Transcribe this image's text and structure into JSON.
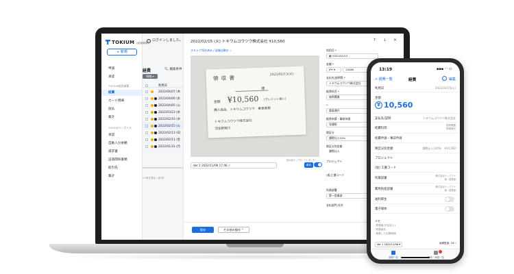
{
  "laptop": {
    "logo": "TOKIUM",
    "logo_sub": "(経費精算)",
    "new_button": "+ 新規",
    "login_message": "ログインしました。",
    "nav": [
      {
        "label": "申請"
      },
      {
        "label": "承認"
      }
    ],
    "nav_section_1": "TOKIUM経費精算",
    "nav_group_1": [
      {
        "label": "経費",
        "active": true
      },
      {
        "label": "カード明細"
      },
      {
        "label": "仮払"
      },
      {
        "label": "集計"
      }
    ],
    "nav_section_2": "TOKIUMインボイス",
    "nav_group_2": [
      {
        "label": "承認"
      },
      {
        "label": "自動入力依頼"
      },
      {
        "label": "請求書"
      },
      {
        "label": "証憑関係書類"
      },
      {
        "label": "取引先"
      },
      {
        "label": "集計"
      }
    ],
    "list": {
      "title": "経費",
      "search": "検索条件",
      "filter": "明細",
      "header_date": "利用日",
      "rows": [
        {
          "date": "2022/04/07 (木"
        },
        {
          "date": "2022/04/06 (水"
        },
        {
          "date": "2022/04/05 (火"
        },
        {
          "date": "2022/03/23 (水"
        },
        {
          "date": "2022/02/16 (水"
        },
        {
          "date": "2022/02/15 (火",
          "selected": true
        },
        {
          "date": "2022/02/13 (日"
        },
        {
          "date": "2022/02/11 (金"
        },
        {
          "date": "2022/01/31 (月"
        }
      ],
      "footer": "1-9件を表示 / 全9件"
    },
    "detail": {
      "title": "2022/02/15 (火)  トキウムコウツウ株式会社   ¥10,560",
      "controls": [
        "↑",
        "↓",
        "✕"
      ],
      "status_link": "スキャナ保存済み / 画像自動の ✓",
      "receipt": {
        "title": "領 収 書",
        "date": "2022/02/15(火)",
        "sama": "様",
        "amount_label": "金額",
        "amount": "¥10,560",
        "note": "(クレジット扱い)",
        "purpose": "購入商品　トキウムコウツウ　乗車券類",
        "issuer": "トキウムコウツウ株式会社",
        "issuer2": "羽生駅発行"
      },
      "version_select": "Ver 1  2022/11/06 17:46 ✓",
      "version_hint": "最大版アップロードしました",
      "version_badge": "原本",
      "fields": {
        "date_label": "利用日 *",
        "date_value": "2022/02/15",
        "amount_label": "金額 *",
        "currency": "JPY",
        "amount_value": "10560",
        "payee_label": "支払先/説明等 *",
        "payee_value": "トキウムコウツウ株式会社",
        "category_label": "経費科目 *",
        "category_value": "旅費関連",
        "sub_label": "*",
        "sub_value": "電車運代",
        "tax_label": "経費申請・事前申請",
        "tax_value": "非課税",
        "rate_label": "税区分",
        "rate_value": "課税仕入10%",
        "tax_amount_label": "税区分別金額",
        "tax_amount_value": "課税仕入",
        "tax_amount_right": "10(",
        "project_label": "プロジェクト",
        "project_right": "未入力",
        "code_label": "(仮)工番コード",
        "code_right": "未入力",
        "dept_label": "所属部署",
        "dept_value": "第一営業部",
        "more_label": "支払部門-社外"
      },
      "save_button": "保存",
      "other_button": "その他の操作 ^"
    }
  },
  "phone": {
    "time": "13:19",
    "status": "▪▪▪ ◠ ▭",
    "back": "< 経費一覧",
    "title": "経費",
    "more": "…",
    "edit": "編集",
    "rows": [
      {
        "k": "利用日",
        "v": "2022/02/15(火)"
      },
      {
        "k": "金額",
        "v": ""
      },
      {
        "k": "支払先/説明",
        "v": "トキウムコウツウ株式会社"
      },
      {
        "k": "経費科目",
        "v": "旅費関連\n電車運代"
      },
      {
        "k": "経費申請・事前申請",
        "v": ""
      },
      {
        "k": "税区分別金額",
        "v": "課税仕入(10%)　¥10,560"
      },
      {
        "k": "プロジェクト",
        "v": ""
      },
      {
        "k": "(仮) 工番コード",
        "v": ""
      },
      {
        "k": "所属部署",
        "v": "株式会社テックアド\n第一営業部"
      },
      {
        "k": "費用負担部署",
        "v": "株式会社テックアド\n第一営業部"
      },
      {
        "k": "福利厚生",
        "v": ""
      },
      {
        "k": "電子媒体",
        "v": ""
      }
    ],
    "amount_label": "金額",
    "amount": "10,560",
    "memo_label": "メモ",
    "memo_lines": [
      "-受領者(氏名記入)",
      "-受領者名",
      "-乗車した区間明細"
    ],
    "version": "Ver 1 2022/11/06 ▾",
    "version_right": "画像監査: OK ✓",
    "tabs": [
      {
        "label": "経費一覧",
        "active": true
      },
      {
        "label": "申請・承認一覧",
        "badge": true
      }
    ],
    "colors": {
      "accent": "#1d6fe0",
      "warning": "#f0b400"
    }
  }
}
